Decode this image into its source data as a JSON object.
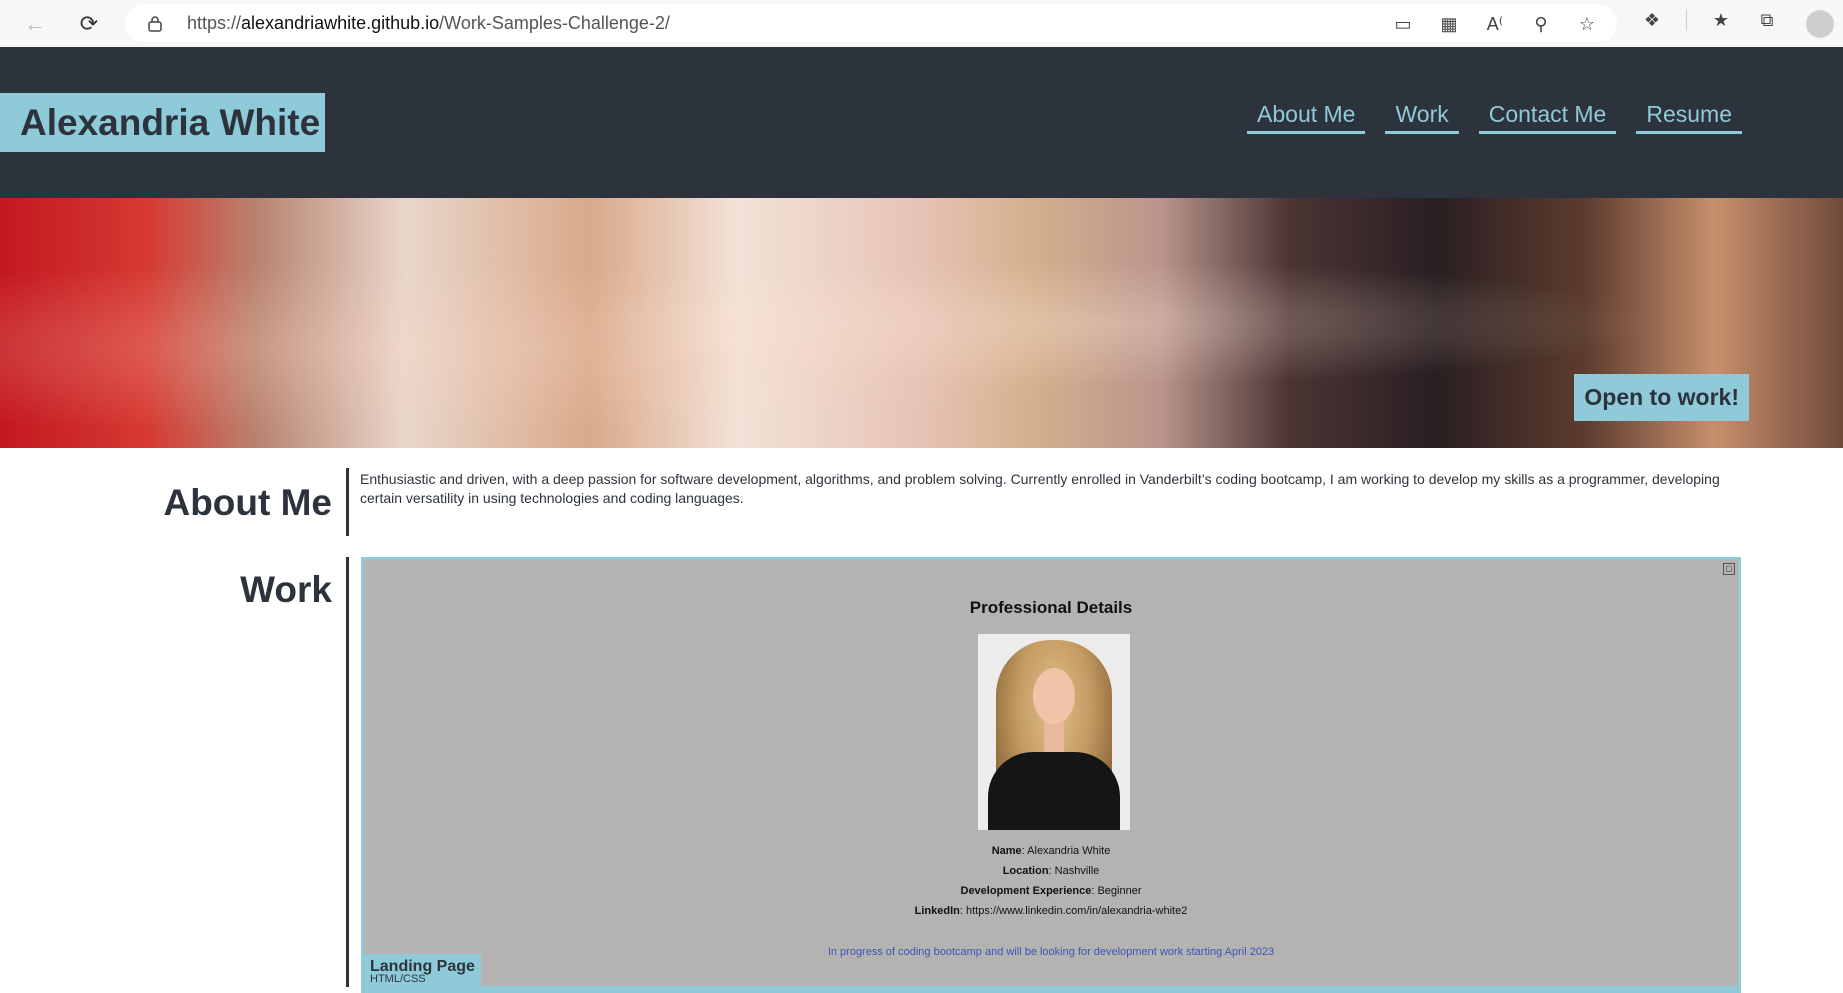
{
  "browser": {
    "url_prefix": "https://",
    "url_host": "alexandriawhite.github.io",
    "url_path": "/Work-Samples-Challenge-2/"
  },
  "site": {
    "brand": "Alexandria White",
    "nav": [
      "About Me",
      "Work",
      "Contact Me",
      "Resume"
    ],
    "hero_badge": "Open to work!"
  },
  "about": {
    "title": "About Me",
    "text": "Enthusiastic and driven, with a deep passion for software development, algorithms, and problem solving. Currently enrolled in Vanderbilt’s coding bootcamp, I am working to develop my skills as a programmer, developing certain versatility in using technologies and coding languages."
  },
  "work": {
    "title": "Work",
    "card": {
      "heading": "Professional Details",
      "name_label": "Name",
      "name_value": ": Alexandria White",
      "location_label": "Location",
      "location_value": ": Nashville",
      "experience_label": "Development Experience",
      "experience_value": ": Beginner",
      "linkedin_label": "LinkedIn",
      "linkedin_value": ": https://www.linkedin.com/in/alexandria-white2",
      "note": "In progress of coding bootcamp and will be looking for development work starting April 2023",
      "label_title": "Landing Page",
      "label_sub": "HTML/CSS"
    }
  },
  "colors": {
    "header_bg": "#2d333d",
    "accent": "#8fcad8"
  }
}
